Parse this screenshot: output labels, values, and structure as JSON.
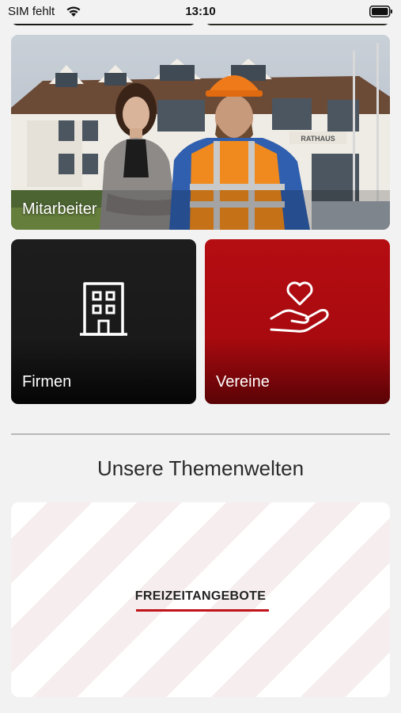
{
  "status_bar": {
    "carrier": "SIM fehlt",
    "time": "13:10"
  },
  "tiles": {
    "mitarbeiter": {
      "label": "Mitarbeiter"
    },
    "firmen": {
      "label": "Firmen",
      "icon": "building-icon"
    },
    "vereine": {
      "label": "Vereine",
      "icon": "heart-hand-icon"
    }
  },
  "photo": {
    "sign_text": "RATHAUS"
  },
  "section": {
    "title": "Unsere Themenwelten"
  },
  "theme_cards": [
    {
      "label": "FREIZEITANGEBOTE"
    }
  ],
  "colors": {
    "accent_red": "#b50d12",
    "dark_tile": "#1a1a1a",
    "underline": "#c0141a"
  }
}
